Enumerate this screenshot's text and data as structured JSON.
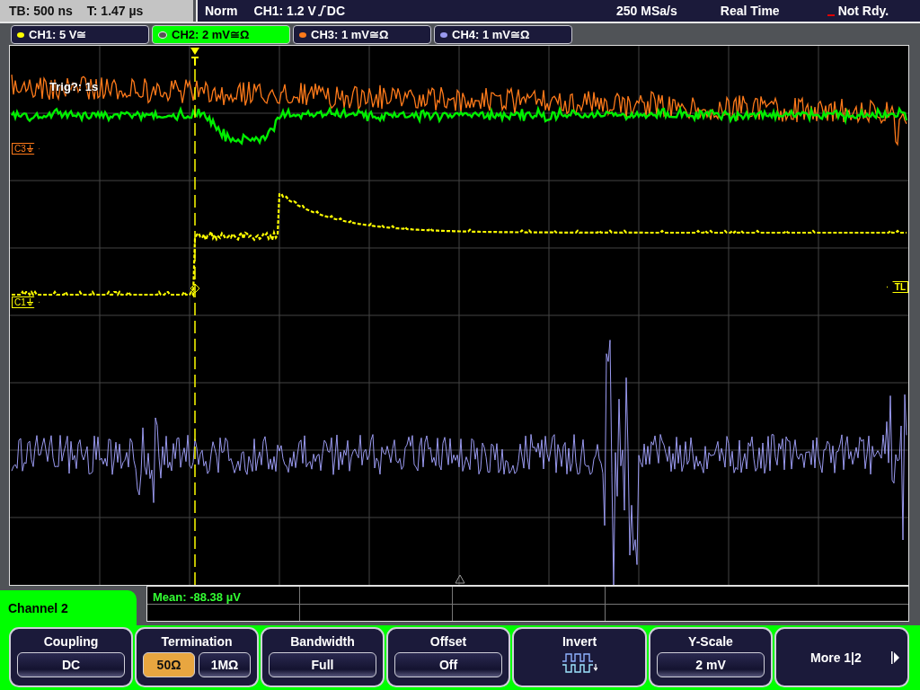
{
  "status_bar": {
    "timebase": "TB: 500 ns",
    "trigger_time": "T: 1.47 µs",
    "trigger_mode": "Norm",
    "trigger_source": "CH1: 1.2 V",
    "trigger_coupling": "DC",
    "sample_rate": "250 MSa/s",
    "acquisition_mode": "Real Time",
    "state": "Not Rdy."
  },
  "channel_tabs": [
    {
      "label": "CH1: 5 V≅",
      "color": "#ffff00",
      "selected": false
    },
    {
      "label": "CH2: 2 mV≅Ω",
      "color": "#00ee00",
      "selected": true
    },
    {
      "label": "CH3: 1 mV≅Ω",
      "color": "#ff7a1a",
      "selected": false
    },
    {
      "label": "CH4: 1 mV≅Ω",
      "color": "#9a9af0",
      "selected": false
    }
  ],
  "plot": {
    "trigger_message": "Trig?: 1s",
    "markers": [
      {
        "label": "C3",
        "color": "#ff7a1a",
        "kind": "ground"
      },
      {
        "label": "C1",
        "color": "#ffff00",
        "kind": "ground"
      },
      {
        "label": "TL",
        "color": "#ffff00",
        "kind": "trigger_level"
      }
    ]
  },
  "measurement": {
    "label": "Mean: -88.38 µV"
  },
  "menu": {
    "title": "Channel 2",
    "softkeys": [
      {
        "kind": "value",
        "label": "Coupling",
        "value": "DC"
      },
      {
        "kind": "choice",
        "label": "Termination",
        "options": [
          {
            "label": "50Ω",
            "selected": true
          },
          {
            "label": "1MΩ",
            "selected": false
          }
        ]
      },
      {
        "kind": "value",
        "label": "Bandwidth",
        "value": "Full"
      },
      {
        "kind": "value",
        "label": "Offset",
        "value": "Off"
      },
      {
        "kind": "invert",
        "label": "Invert"
      },
      {
        "kind": "value",
        "label": "Y-Scale",
        "value": "2 mV"
      },
      {
        "kind": "more",
        "label": "More 1|2"
      }
    ]
  }
}
